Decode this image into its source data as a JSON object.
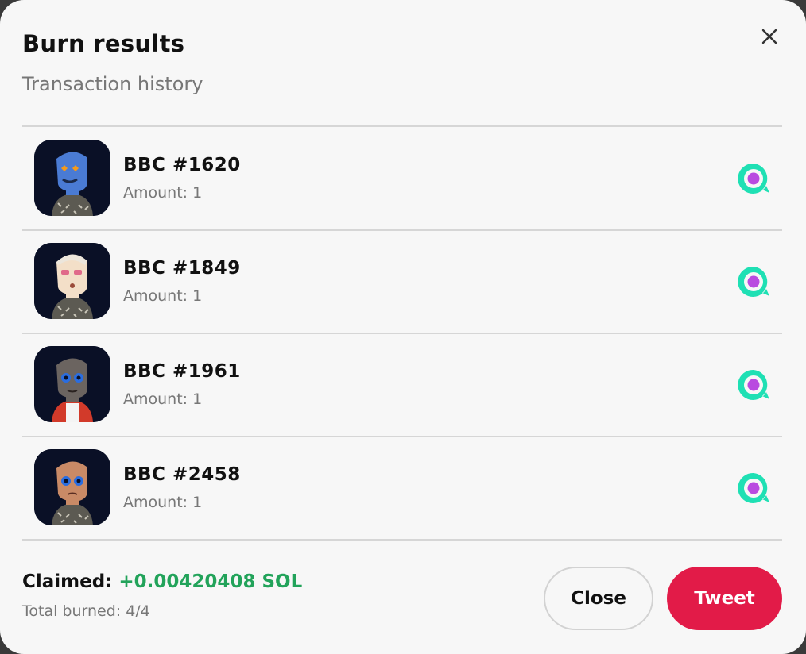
{
  "dialog": {
    "title": "Burn results",
    "subtitle": "Transaction history"
  },
  "results": [
    {
      "name": "BBC #1620",
      "amount_label": "Amount:",
      "amount": "1"
    },
    {
      "name": "BBC #1849",
      "amount_label": "Amount:",
      "amount": "1"
    },
    {
      "name": "BBC #1961",
      "amount_label": "Amount:",
      "amount": "1"
    },
    {
      "name": "BBC #2458",
      "amount_label": "Amount:",
      "amount": "1"
    }
  ],
  "footer": {
    "claimed_label": "Claimed:",
    "claimed_value": "+0.00420408 SOL",
    "total_label": "Total burned:",
    "total_value": "4/4"
  },
  "buttons": {
    "close": "Close",
    "tweet": "Tweet"
  },
  "icons": {
    "close": "close-icon",
    "explorer": "solscan-explorer-icon",
    "avatar": "nft-avatar"
  },
  "colors": {
    "accent": "#e21b48",
    "positive": "#22a35a",
    "explorer_ring": "#1fe0b4",
    "explorer_dot": "#b94be0"
  }
}
